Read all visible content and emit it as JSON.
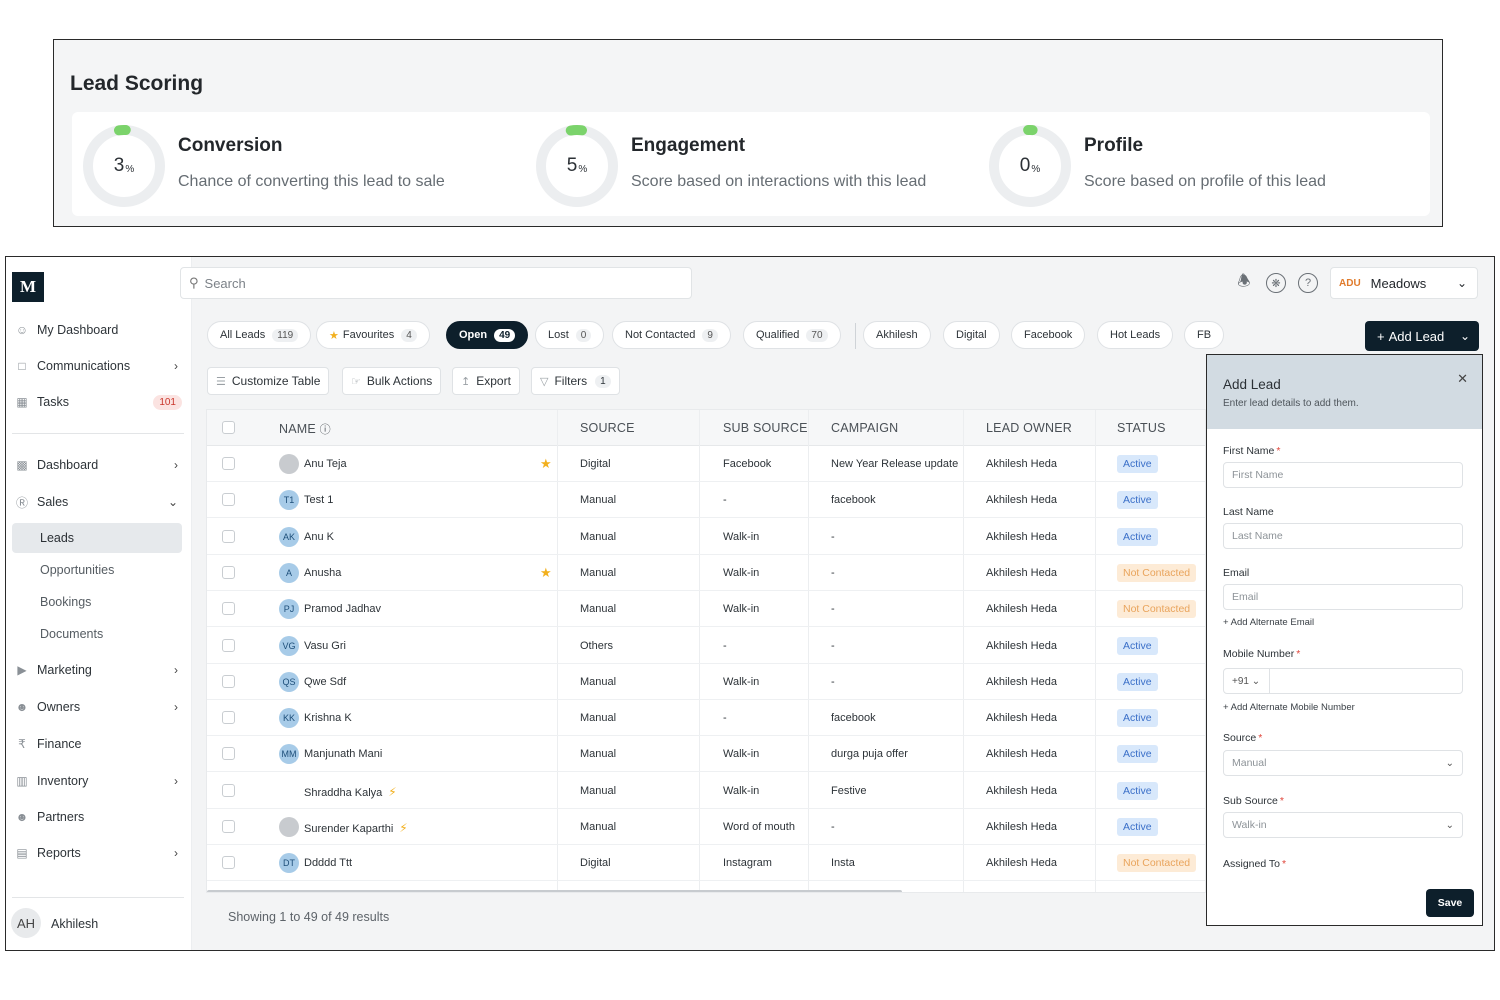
{
  "lead_scoring": {
    "title": "Lead Scoring",
    "metrics": [
      {
        "value": "3",
        "unit": "%",
        "title": "Conversion",
        "desc": "Chance of converting this lead to sale",
        "percent": 3
      },
      {
        "value": "5",
        "unit": "%",
        "title": "Engagement",
        "desc": "Score based on interactions with this lead",
        "percent": 5
      },
      {
        "value": "0",
        "unit": "%",
        "title": "Profile",
        "desc": "Score based on profile of this lead",
        "percent": 0
      }
    ],
    "ring_color": "#7bd36b"
  },
  "sidebar": {
    "logo": "M",
    "items": [
      {
        "label": "My Dashboard",
        "icon": "user-icon"
      },
      {
        "label": "Communications",
        "icon": "chat-icon"
      },
      {
        "label": "Tasks",
        "icon": "calendar-icon",
        "badge": "101"
      },
      {
        "label": "Dashboard",
        "icon": "bar-chart-icon"
      },
      {
        "label": "Sales",
        "icon": "dollar-icon"
      },
      {
        "label": "Leads"
      },
      {
        "label": "Opportunities"
      },
      {
        "label": "Bookings"
      },
      {
        "label": "Documents"
      },
      {
        "label": "Marketing",
        "icon": "megaphone-icon"
      },
      {
        "label": "Owners",
        "icon": "users-icon"
      },
      {
        "label": "Finance",
        "icon": "rupee-icon"
      },
      {
        "label": "Inventory",
        "icon": "building-icon"
      },
      {
        "label": "Partners",
        "icon": "partners-icon"
      },
      {
        "label": "Reports",
        "icon": "report-icon"
      }
    ],
    "user": {
      "initials": "AH",
      "name": "Akhilesh"
    }
  },
  "topbar": {
    "search_placeholder": "Search",
    "org_logo": "ADU",
    "org_name": "Meadows"
  },
  "chips": [
    {
      "label": "All Leads",
      "count": "119"
    },
    {
      "label": "Favourites",
      "count": "4"
    },
    {
      "label": "Open",
      "count": "49"
    },
    {
      "label": "Lost",
      "count": "0"
    },
    {
      "label": "Not Contacted",
      "count": "9"
    },
    {
      "label": "Qualified",
      "count": "70"
    },
    {
      "label": "Akhilesh"
    },
    {
      "label": "Digital"
    },
    {
      "label": "Facebook"
    },
    {
      "label": "Hot Leads"
    },
    {
      "label": "FB"
    }
  ],
  "add_lead_button": "Add Lead",
  "toolbar": {
    "customize": "Customize Table",
    "bulk": "Bulk Actions",
    "export": "Export",
    "filters": "Filters",
    "filters_count": "1"
  },
  "table": {
    "columns": [
      "NAME",
      "SOURCE",
      "SUB SOURCE",
      "CAMPAIGN",
      "LEAD OWNER",
      "STATUS"
    ],
    "rows": [
      {
        "initials": "",
        "name": "Anu Teja",
        "star": true,
        "bolt": false,
        "photo": true,
        "source": "Digital",
        "sub_source": "Facebook",
        "campaign": "New Year Release update",
        "owner": "Akhilesh Heda",
        "status": "Active"
      },
      {
        "initials": "T1",
        "name": "Test 1",
        "star": false,
        "bolt": false,
        "source": "Manual",
        "sub_source": "-",
        "campaign": "facebook",
        "owner": "Akhilesh Heda",
        "status": "Active"
      },
      {
        "initials": "AK",
        "name": "Anu K",
        "star": false,
        "bolt": false,
        "source": "Manual",
        "sub_source": "Walk-in",
        "campaign": "-",
        "owner": "Akhilesh Heda",
        "status": "Active"
      },
      {
        "initials": "A",
        "name": "Anusha",
        "star": true,
        "bolt": false,
        "source": "Manual",
        "sub_source": "Walk-in",
        "campaign": "-",
        "owner": "Akhilesh Heda",
        "status": "Not Contacted"
      },
      {
        "initials": "PJ",
        "name": "Pramod Jadhav",
        "star": false,
        "bolt": false,
        "source": "Manual",
        "sub_source": "Walk-in",
        "campaign": "-",
        "owner": "Akhilesh Heda",
        "status": "Not Contacted"
      },
      {
        "initials": "VG",
        "name": "Vasu Gri",
        "star": false,
        "bolt": false,
        "source": "Others",
        "sub_source": "-",
        "campaign": "-",
        "owner": "Akhilesh Heda",
        "status": "Active"
      },
      {
        "initials": "QS",
        "name": "Qwe Sdf",
        "star": false,
        "bolt": false,
        "source": "Manual",
        "sub_source": "Walk-in",
        "campaign": "-",
        "owner": "Akhilesh Heda",
        "status": "Active"
      },
      {
        "initials": "KK",
        "name": "Krishna K",
        "star": false,
        "bolt": false,
        "source": "Manual",
        "sub_source": "-",
        "campaign": "facebook",
        "owner": "Akhilesh Heda",
        "status": "Active"
      },
      {
        "initials": "MM",
        "name": "Manjunath Mani",
        "star": false,
        "bolt": false,
        "source": "Manual",
        "sub_source": "Walk-in",
        "campaign": "durga puja offer",
        "owner": "Akhilesh Heda",
        "status": "Active"
      },
      {
        "initials": "",
        "name": "Shraddha Kalya",
        "star": false,
        "bolt": true,
        "none": true,
        "source": "Manual",
        "sub_source": "Walk-in",
        "campaign": "Festive",
        "owner": "Akhilesh Heda",
        "status": "Active"
      },
      {
        "initials": "",
        "name": "Surender Kaparthi",
        "star": false,
        "bolt": true,
        "photo": true,
        "source": "Manual",
        "sub_source": "Word of mouth",
        "campaign": "-",
        "owner": "Akhilesh Heda",
        "status": "Active"
      },
      {
        "initials": "DT",
        "name": "Ddddd Ttt",
        "star": false,
        "bolt": false,
        "source": "Digital",
        "sub_source": "Instagram",
        "campaign": "Insta",
        "owner": "Akhilesh Heda",
        "status": "Not Contacted"
      }
    ],
    "footer": "Showing 1 to 49 of 49 results"
  },
  "panel": {
    "title": "Add Lead",
    "subtitle": "Enter lead details to add them.",
    "first_name_label": "First Name",
    "first_name_placeholder": "First Name",
    "last_name_label": "Last Name",
    "last_name_placeholder": "Last Name",
    "email_label": "Email",
    "email_placeholder": "Email",
    "add_email": "Add Alternate Email",
    "mobile_label": "Mobile Number",
    "dial_code": "+91",
    "add_mobile": "Add Alternate Mobile Number",
    "source_label": "Source",
    "source_value": "Manual",
    "sub_source_label": "Sub Source",
    "sub_source_value": "Walk-in",
    "assigned_label": "Assigned To",
    "save": "Save"
  }
}
